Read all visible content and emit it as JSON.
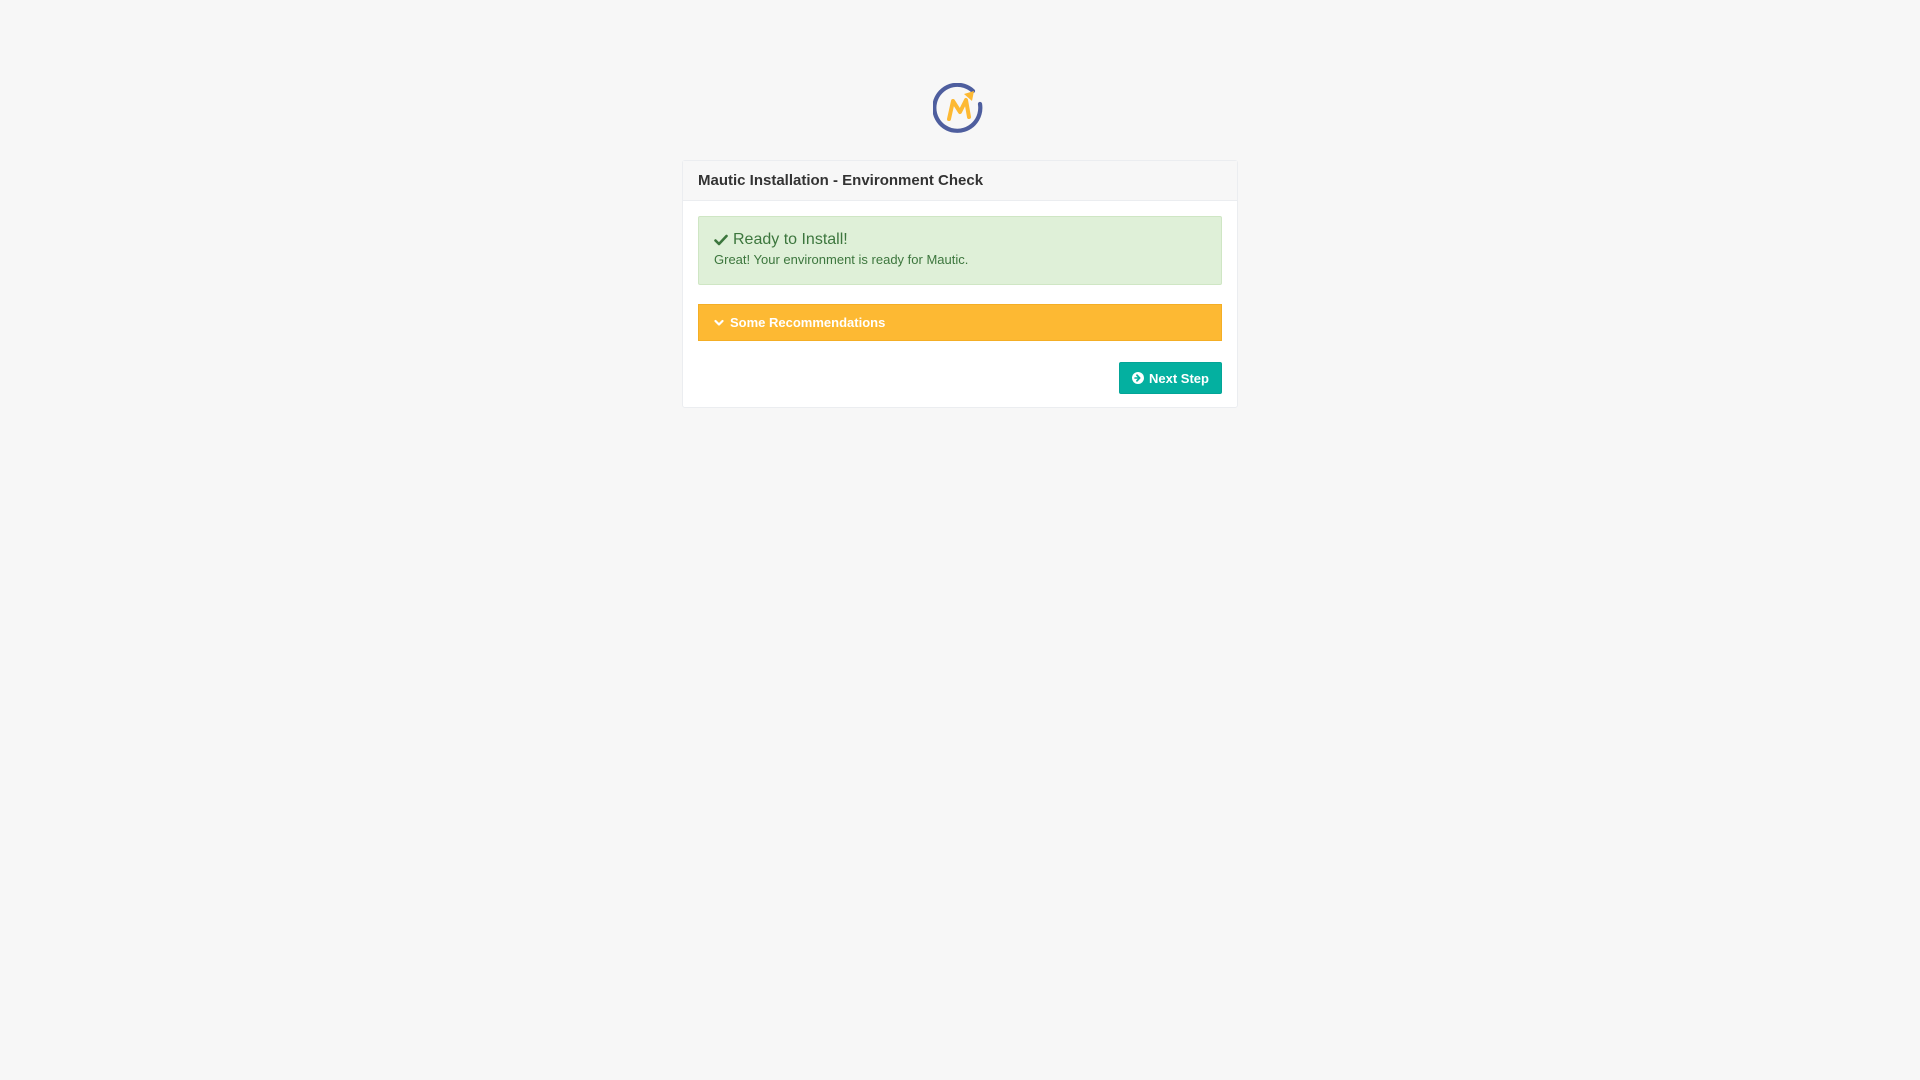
{
  "logo": {
    "icon": "mautic-logo",
    "colors": {
      "ring": "#4e5e9e",
      "mark": "#fdb933"
    }
  },
  "panel": {
    "title": "Mautic Installation - Environment Check"
  },
  "alert": {
    "icon": "check-icon",
    "title": "Ready to Install!",
    "message": "Great! Your environment is ready for Mautic.",
    "color": "#3c763d",
    "background": "#dff0d8"
  },
  "recommendations": {
    "icon": "chevron-down-icon",
    "label": "Some Recommendations",
    "background": "#fdb933"
  },
  "next_button": {
    "icon": "arrow-circle-right-icon",
    "label": "Next Step",
    "background": "#04b0a0"
  }
}
